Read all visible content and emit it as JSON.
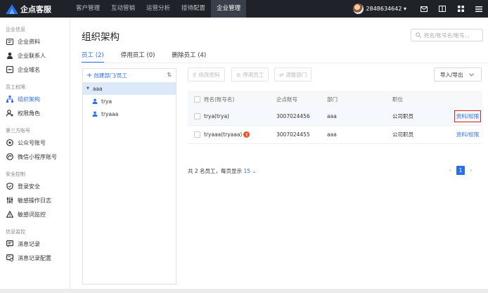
{
  "brand": {
    "name": "企点客服",
    "logo_color": "#2b6ee6"
  },
  "nav": [
    {
      "label": "客户管理",
      "active": false
    },
    {
      "label": "互动营销",
      "active": false
    },
    {
      "label": "运营分析",
      "active": false
    },
    {
      "label": "接待配置",
      "active": false
    },
    {
      "label": "企业管理",
      "active": true
    }
  ],
  "account": {
    "id": "2848634642 ▾"
  },
  "sidebar": {
    "groups": [
      {
        "title": "企业信息",
        "items": [
          {
            "label": "企业资料",
            "icon": "profile-card-icon"
          },
          {
            "label": "企业联系人",
            "icon": "contact-person-icon"
          },
          {
            "label": "企业域名",
            "icon": "domain-icon"
          }
        ]
      },
      {
        "title": "员工权限",
        "items": [
          {
            "label": "组织架构",
            "icon": "org-chart-icon",
            "active": true
          },
          {
            "label": "权限角色",
            "icon": "role-icon"
          }
        ]
      },
      {
        "title": "第三方账号",
        "items": [
          {
            "label": "公众号账号",
            "icon": "official-account-icon"
          },
          {
            "label": "微信小程序账号",
            "icon": "mini-program-icon"
          }
        ]
      },
      {
        "title": "安全控制",
        "items": [
          {
            "label": "登录安全",
            "icon": "shield-icon"
          },
          {
            "label": "敏感操作日志",
            "icon": "sliders-icon"
          },
          {
            "label": "敏感词监控",
            "icon": "warning-icon"
          }
        ]
      },
      {
        "title": "信息监控",
        "items": [
          {
            "label": "消息记录",
            "icon": "message-record-icon"
          },
          {
            "label": "消息记录配置",
            "icon": "message-config-icon"
          }
        ]
      }
    ]
  },
  "page": {
    "title": "组织架构",
    "search_placeholder": "姓名/账号名/账号..."
  },
  "tabs": [
    {
      "label": "员工 (2)",
      "active": true
    },
    {
      "label": "停用员工 (0)",
      "active": false
    },
    {
      "label": "删除员工 (4)",
      "active": false
    }
  ],
  "tree": {
    "create_label": "创建部门/员工",
    "sort_symbol": "⇅",
    "root": "aaa",
    "members": [
      "trya",
      "tryaaa"
    ]
  },
  "toolbar": {
    "edit_label": "修改密码",
    "disable_label": "停用员工",
    "move_label": "调整部门",
    "import_label": "导入/导出"
  },
  "table": {
    "headers": {
      "name": "姓名(账号名)",
      "account": "企点账号",
      "dept": "部门",
      "position": "职位"
    },
    "rows": [
      {
        "name": "trya(trya)",
        "account": "3007024456",
        "dept": "aaa",
        "position": "公司职员",
        "action": "资料/权限",
        "warn": false,
        "highlight": true
      },
      {
        "name": "tryaaa(tryaaa)",
        "account": "3007024455",
        "dept": "aaa",
        "position": "公司职员",
        "action": "资料/权限",
        "warn": true,
        "highlight": false
      }
    ]
  },
  "footer": {
    "prefix": "共 2 名员工，每页显示",
    "page_size": "15",
    "current_page": "1"
  }
}
